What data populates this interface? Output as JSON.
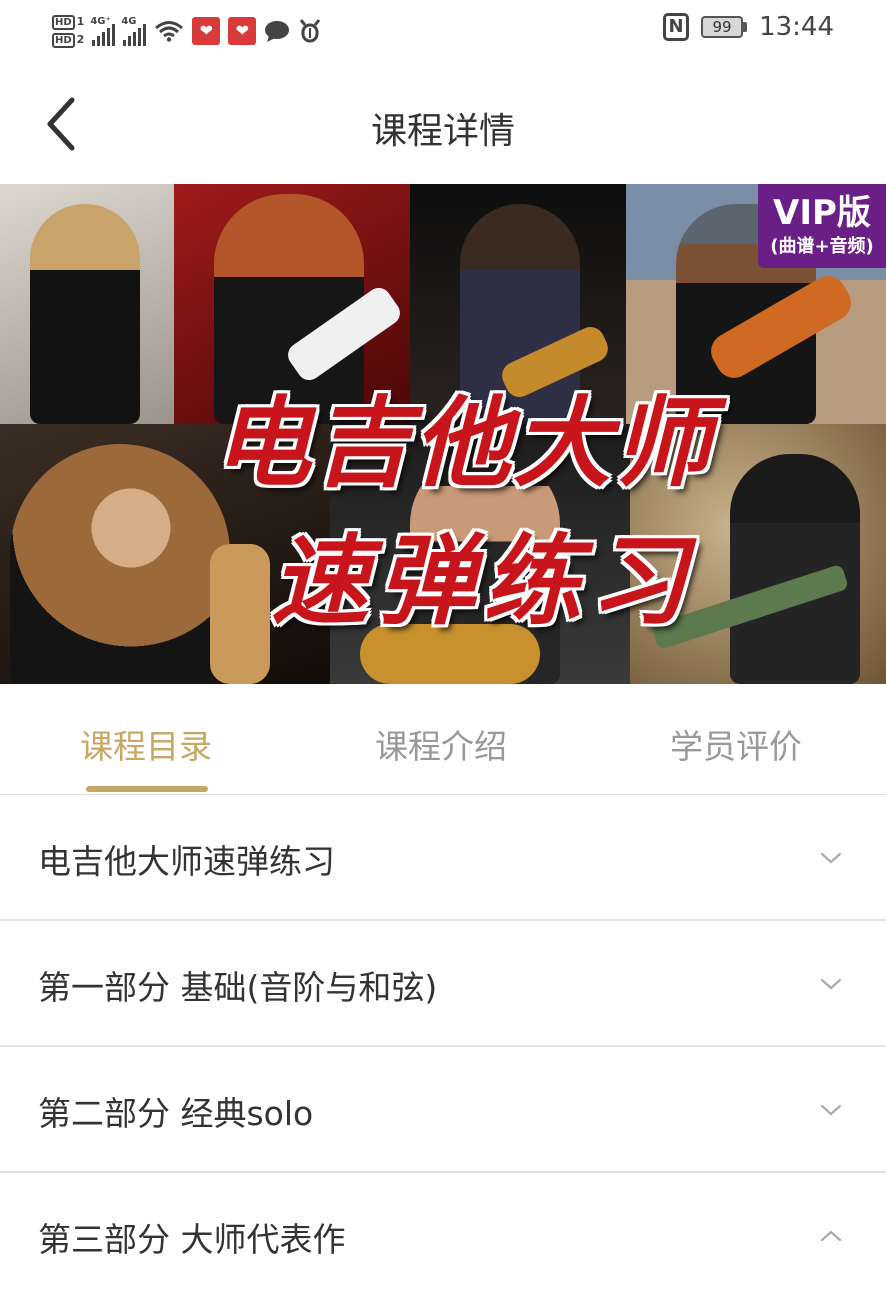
{
  "status_bar": {
    "sim1": "HD",
    "sim1_index": "1",
    "sim2": "HD",
    "sim2_index": "2",
    "net1": "4G⁺",
    "net2": "4G",
    "battery": "99",
    "time": "13:44",
    "icons": [
      "signal-icon",
      "wifi-icon",
      "app-notification-icon",
      "message-icon",
      "bug-icon",
      "nfc-icon",
      "battery-icon"
    ]
  },
  "header": {
    "title": "课程详情"
  },
  "banner": {
    "line1": "电吉他大师",
    "line2": "速弹练习",
    "badge_main": "VIP版",
    "badge_sub": "(曲谱+音频)"
  },
  "tabs": [
    {
      "label": "课程目录",
      "active": true
    },
    {
      "label": "课程介绍",
      "active": false
    },
    {
      "label": "学员评价",
      "active": false
    }
  ],
  "sections": [
    {
      "label": "电吉他大师速弹练习",
      "expanded": false
    },
    {
      "label": "第一部分 基础(音阶与和弦)",
      "expanded": false
    },
    {
      "label": "第二部分 经典solo",
      "expanded": false
    },
    {
      "label": "第三部分 大师代表作",
      "expanded": true
    }
  ],
  "colors": {
    "accent": "#c8a664",
    "vip_badge": "#6a1f86",
    "banner_text": "#c8141b"
  }
}
